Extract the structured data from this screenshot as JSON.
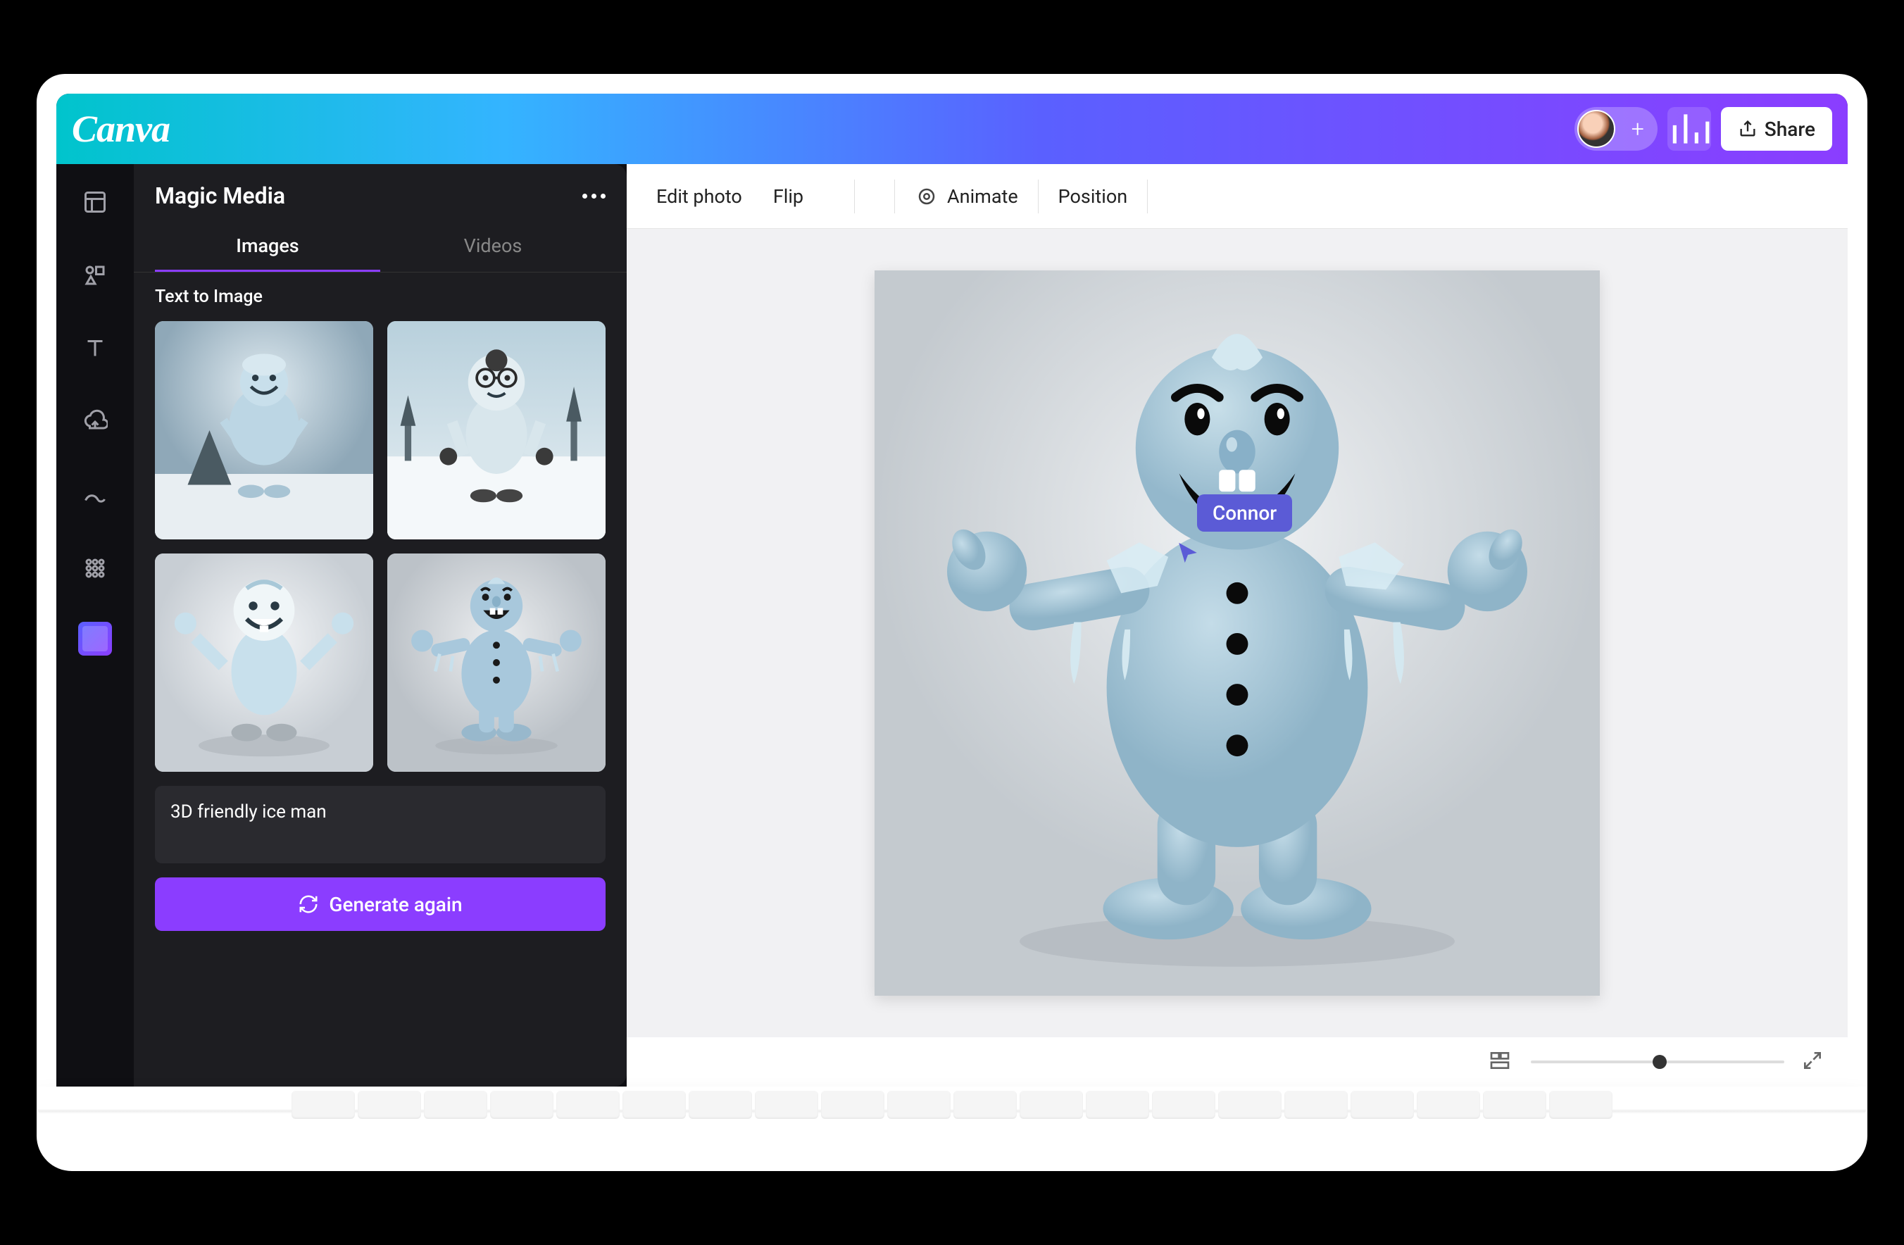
{
  "brand": "Canva",
  "header": {
    "share_label": "Share"
  },
  "panel": {
    "title": "Magic Media",
    "tabs": {
      "images": "Images",
      "videos": "Videos"
    },
    "section_label": "Text to Image",
    "prompt_value": "3D friendly ice man",
    "generate_label": "Generate again"
  },
  "context_bar": {
    "edit_photo": "Edit photo",
    "flip": "Flip",
    "animate": "Animate",
    "position": "Position"
  },
  "collaborator": {
    "name": "Connor"
  },
  "footer": {
    "zoom_percent": 48
  }
}
